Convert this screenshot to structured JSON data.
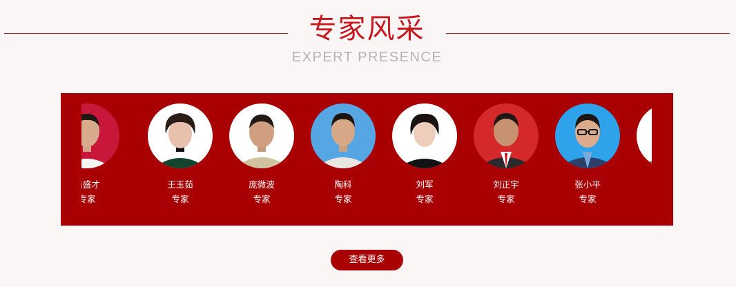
{
  "header": {
    "title": "专家风采",
    "subtitle": "EXPERT PRESENCE"
  },
  "colors": {
    "accent": "#c9171e",
    "band": "#a80003",
    "page_background": "#faf6f5"
  },
  "experts": [
    {
      "name": "蒲盛才",
      "role": "专家"
    },
    {
      "name": "王玉茹",
      "role": "专家"
    },
    {
      "name": "庞微波",
      "role": "专家"
    },
    {
      "name": "陶科",
      "role": "专家"
    },
    {
      "name": "刘军",
      "role": "专家"
    },
    {
      "name": "刘正宇",
      "role": "专家"
    },
    {
      "name": "张小平",
      "role": "专家"
    }
  ],
  "more_button": {
    "label": "查看更多"
  }
}
